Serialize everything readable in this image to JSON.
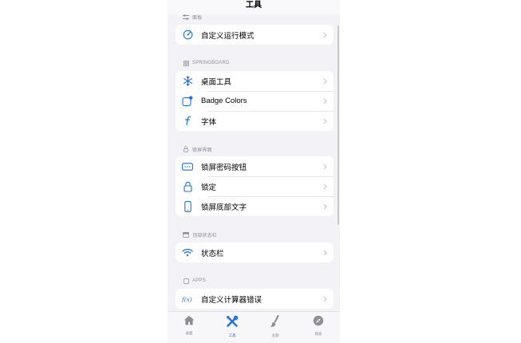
{
  "nav": {
    "title": "工具"
  },
  "sections": [
    {
      "id": "panel",
      "header": "面板",
      "rows": [
        {
          "label": "自定义运行模式",
          "icon": "speedometer-icon"
        }
      ]
    },
    {
      "id": "springboard",
      "header": "SPRINGBOARD",
      "rows": [
        {
          "label": "桌面工具",
          "icon": "snowflake-icon"
        },
        {
          "label": "Badge Colors",
          "icon": "app-badge-icon"
        },
        {
          "label": "字体",
          "icon": "function-f-icon"
        }
      ]
    },
    {
      "id": "lockscreen",
      "header": "锁屏界面",
      "rows": [
        {
          "label": "锁屏密码按钮",
          "icon": "passcode-icon"
        },
        {
          "label": "锁定",
          "icon": "lock-icon"
        },
        {
          "label": "锁屏底部文字",
          "icon": "iphone-icon"
        }
      ]
    },
    {
      "id": "statusbar",
      "header": "顶部状态栏",
      "rows": [
        {
          "label": "状态栏",
          "icon": "wifi-icon"
        }
      ]
    },
    {
      "id": "apps",
      "header": "APPS",
      "rows": [
        {
          "label": "自定义计算器错误",
          "icon": "fx-icon"
        }
      ]
    }
  ],
  "tabbar": {
    "items": [
      {
        "label": "桌面",
        "icon": "house-icon",
        "active": false
      },
      {
        "label": "工具",
        "icon": "tools-icon",
        "active": true
      },
      {
        "label": "主题",
        "icon": "paintbrush-icon",
        "active": false
      },
      {
        "label": "探索",
        "icon": "compass-icon",
        "active": false
      }
    ]
  },
  "colors": {
    "accent": "#1f6fe5",
    "background": "#f2f2f7",
    "card": "#ffffff",
    "secondary_text": "#8e8e93"
  }
}
